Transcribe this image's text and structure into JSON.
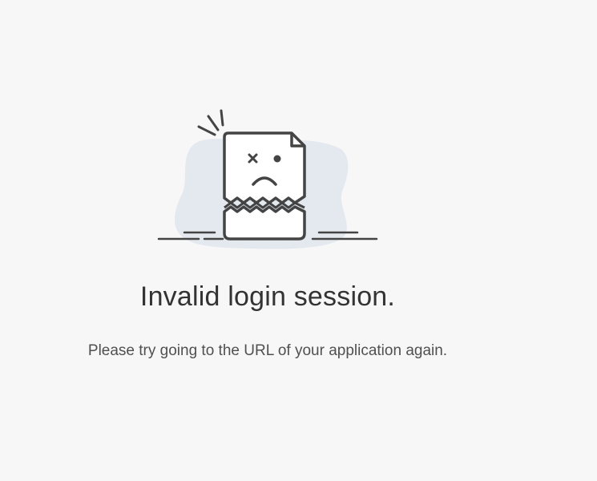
{
  "error": {
    "illustration_icon": "broken-document-sad-face-icon",
    "title": "Invalid login session.",
    "message": "Please try going to the URL of your application again."
  },
  "colors": {
    "background": "#f7f7f7",
    "blob": "#e4e9f0",
    "stroke": "#444444",
    "title": "#333333",
    "message": "#505050"
  }
}
